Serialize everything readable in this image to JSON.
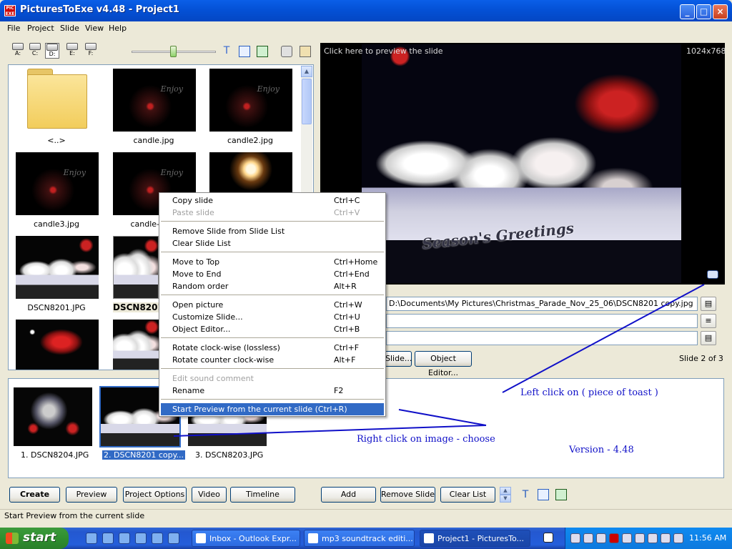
{
  "window": {
    "title": "PicturesToExe v4.48 - Project1",
    "app_icon_text": "PIC EXE",
    "minimize": "_",
    "maximize": "□",
    "close": "×"
  },
  "menu": [
    "File",
    "Project",
    "Slide",
    "View",
    "Help"
  ],
  "toolbar": {
    "drives": [
      "A:",
      "C:",
      "D:",
      "E:",
      "F:"
    ],
    "selected_drive": "D:",
    "text_tool_glyph": "T"
  },
  "files": [
    {
      "label": "<..>",
      "kind": "folder"
    },
    {
      "label": "candle.jpg",
      "kind": "candle"
    },
    {
      "label": "candle2.jpg",
      "kind": "candle"
    },
    {
      "label": "candle3.jpg",
      "kind": "candle"
    },
    {
      "label": "candle-",
      "kind": "candle"
    },
    {
      "label": "DSCN8201.JPG",
      "kind": "parade"
    },
    {
      "label": "DSCN8201",
      "kind": "parade"
    }
  ],
  "thumb_caption": "Enjoy",
  "preview": {
    "hint": "Click here to preview the slide",
    "resolution": "1024x768",
    "banner": "Season's Greetings"
  },
  "fields": {
    "picture_path": "D:\\Documents\\My Pictures\\Christmas_Parade_Nov_25_06\\DSCN8201 copy.jpg",
    "slide_button": "Slide...",
    "object_editor_button": "Object Editor...",
    "slide_count": "Slide 2 of 3"
  },
  "slides": [
    {
      "label": "1. DSCN8204.JPG"
    },
    {
      "label": "2. DSCN8201 copy..."
    },
    {
      "label": "3. DSCN8203.JPG"
    }
  ],
  "annotations": {
    "left_click": "Left click on ( piece of toast )",
    "right_click": "Right  click on image - choose",
    "version": "Version - 4.48"
  },
  "context_menu": {
    "items": [
      {
        "label": "Copy slide",
        "shortcut": "Ctrl+C"
      },
      {
        "label": "Paste slide",
        "shortcut": "Ctrl+V"
      },
      {
        "label": "Remove Slide from Slide List",
        "shortcut": ""
      },
      {
        "label": "Clear Slide List",
        "shortcut": ""
      },
      {
        "label": "Move to Top",
        "shortcut": "Ctrl+Home"
      },
      {
        "label": "Move to End",
        "shortcut": "Ctrl+End"
      },
      {
        "label": "Random order",
        "shortcut": "Alt+R"
      },
      {
        "label": "Open picture",
        "shortcut": "Ctrl+W"
      },
      {
        "label": "Customize Slide...",
        "shortcut": "Ctrl+U"
      },
      {
        "label": "Object Editor...",
        "shortcut": "Ctrl+B"
      },
      {
        "label": "Rotate clock-wise (lossless)",
        "shortcut": "Ctrl+F"
      },
      {
        "label": "Rotate counter clock-wise",
        "shortcut": "Alt+F"
      },
      {
        "label": "Edit sound comment",
        "shortcut": ""
      },
      {
        "label": "Rename",
        "shortcut": "F2"
      },
      {
        "label": "Start Preview from the current slide  (Ctrl+R)",
        "shortcut": ""
      }
    ],
    "disabled": [
      "Paste slide",
      "Edit sound comment"
    ],
    "highlighted": "Start Preview from the current slide  (Ctrl+R)"
  },
  "buttons": {
    "create": "Create",
    "preview": "Preview",
    "project_options": "Project Options",
    "video": "Video",
    "timeline": "Timeline",
    "add": "Add",
    "remove_slide": "Remove Slide",
    "clear_list": "Clear List"
  },
  "status": "Start Preview from the current slide",
  "taskbar": {
    "start": "start",
    "tasks": [
      {
        "label": "Inbox - Outlook Expr..."
      },
      {
        "label": "mp3 soundtrack editi..."
      },
      {
        "label": "Project1 - PicturesTo..."
      }
    ],
    "clock": "11:56 AM"
  },
  "colors": {
    "titlebar": "#0A5FE8",
    "selection": "#316AC5",
    "annotation": "#1010C8",
    "taskbar": "#245EDB",
    "start": "#2F8F2F"
  }
}
